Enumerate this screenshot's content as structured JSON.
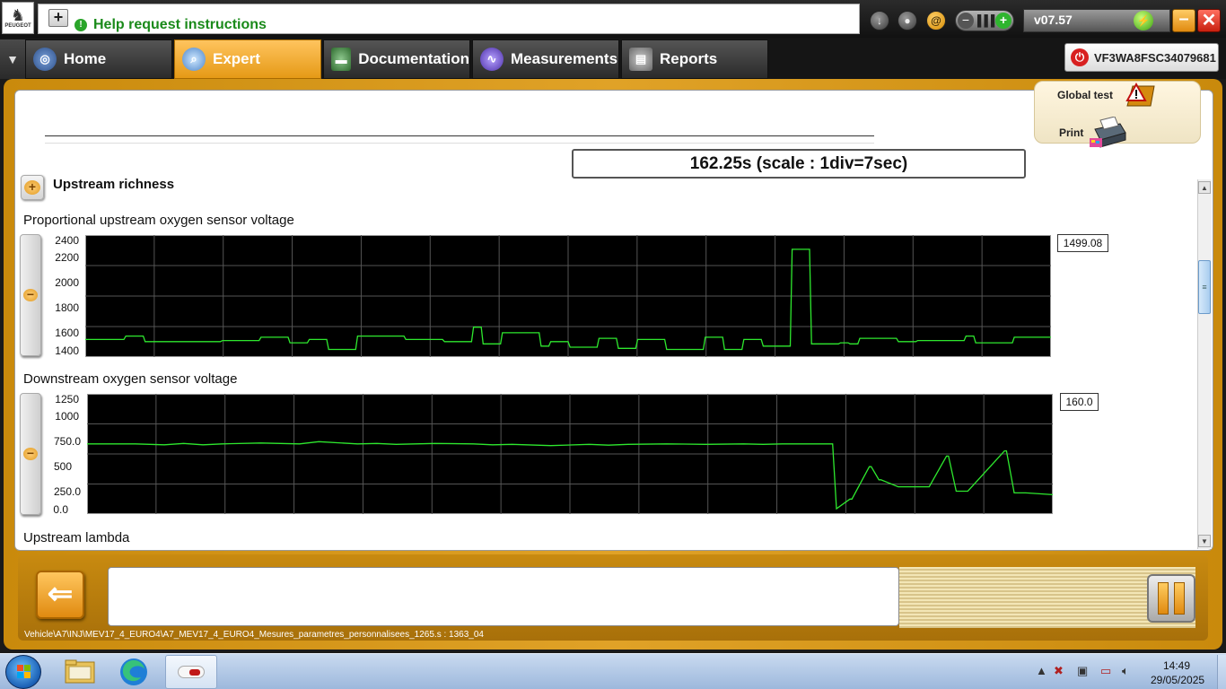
{
  "header": {
    "brand": "PEUGEOT",
    "help_text": "Help request instructions",
    "version": "v07.57"
  },
  "nav": {
    "tabs": [
      {
        "label": "Home",
        "icon": "home-icon"
      },
      {
        "label": "Expert",
        "icon": "magnifier-icon"
      },
      {
        "label": "Documentation",
        "icon": "book-icon"
      },
      {
        "label": "Measurements",
        "icon": "waveform-icon"
      },
      {
        "label": "Reports",
        "icon": "report-icon"
      }
    ],
    "active_tab": "Expert",
    "vin": "VF3WA8FSC34079681"
  },
  "side_panel": {
    "global_test_label": "Global test",
    "print_label": "Print"
  },
  "timebar": "162.25s (scale : 1div=7sec)",
  "group": {
    "title": "Upstream richness"
  },
  "charts_text": {
    "chart1_title": "Proportional upstream oxygen sensor voltage",
    "chart1_value": "1499.08",
    "chart2_title": "Downstream oxygen sensor voltage",
    "chart2_value": "160.0",
    "chart3_title": "Upstream lambda"
  },
  "chart_data": [
    {
      "type": "line",
      "title": "Proportional upstream oxygen sensor voltage",
      "yticks": [
        "2400",
        "2200",
        "2000",
        "1800",
        "1600",
        "1400"
      ],
      "ylim": [
        1400,
        2400
      ],
      "grid": true,
      "color": "#2ee82e",
      "current_value": 1499.08,
      "x": [
        0,
        2,
        4,
        4.2,
        6,
        6.2,
        10,
        10.2,
        14,
        14.2,
        18,
        18.2,
        21,
        21.2,
        23,
        23.2,
        25,
        25.2,
        28,
        28.2,
        33,
        33.2,
        37,
        37.2,
        40,
        40.2,
        41,
        41.2,
        43,
        43.2,
        47,
        47.2,
        48,
        48.2,
        50,
        50.2,
        53,
        53.2,
        55,
        55.2,
        57,
        57.2,
        60,
        60.2,
        64,
        64.2,
        66,
        66.2,
        68,
        68.2,
        70,
        70.2,
        73,
        73.2,
        75,
        75.2,
        78,
        78.2,
        79,
        79.2,
        80,
        80.2,
        84,
        84.2,
        86,
        86.2,
        91,
        91.2,
        92,
        92.2,
        96,
        96.2,
        100
      ],
      "values": [
        1510,
        1510,
        1510,
        1540,
        1540,
        1490,
        1490,
        1490,
        1490,
        1500,
        1500,
        1530,
        1530,
        1480,
        1480,
        1510,
        1510,
        1420,
        1420,
        1540,
        1540,
        1510,
        1510,
        1490,
        1490,
        1620,
        1620,
        1470,
        1470,
        1570,
        1570,
        1450,
        1450,
        1490,
        1490,
        1440,
        1440,
        1520,
        1520,
        1430,
        1430,
        1510,
        1510,
        1420,
        1420,
        1530,
        1530,
        1420,
        1420,
        1510,
        1510,
        1450,
        1450,
        2320,
        2320,
        1470,
        1470,
        1480,
        1480,
        1470,
        1470,
        1520,
        1520,
        1490,
        1490,
        1500,
        1500,
        1540,
        1540,
        1480,
        1480,
        1530,
        1530
      ]
    },
    {
      "type": "line",
      "title": "Downstream oxygen sensor voltage",
      "yticks": [
        "1250",
        "1000",
        "750.0",
        "500",
        "250.0",
        "0.0"
      ],
      "ylim": [
        0,
        1250
      ],
      "grid": true,
      "color": "#2ee82e",
      "current_value": 160.0,
      "x": [
        0,
        5,
        8,
        10,
        12,
        14,
        18,
        22,
        24,
        28,
        30,
        32,
        36,
        40,
        42,
        44,
        48,
        52,
        54,
        56,
        60,
        64,
        68,
        70,
        72,
        76,
        77.2,
        77.6,
        79,
        79.2,
        81,
        81.2,
        82,
        82.2,
        84,
        84.2,
        85,
        85.2,
        87,
        87.2,
        89,
        89.2,
        90,
        90.2,
        91,
        91.2,
        95,
        95.2,
        96,
        96.2,
        97,
        97.2,
        100
      ],
      "values": [
        740,
        740,
        730,
        745,
        730,
        740,
        750,
        740,
        765,
        740,
        745,
        735,
        745,
        740,
        730,
        735,
        720,
        735,
        725,
        735,
        740,
        735,
        740,
        735,
        740,
        740,
        740,
        0,
        110,
        110,
        480,
        480,
        330,
        330,
        250,
        250,
        250,
        250,
        250,
        250,
        600,
        600,
        200,
        200,
        200,
        200,
        660,
        660,
        180,
        180,
        180,
        180,
        160
      ]
    }
  ],
  "footer": {
    "path": "Vehicle\\A7\\INJ\\MEV17_4_EURO4\\A7_MEV17_4_EURO4_Mesures_parametres_personnalisees_1265.s : 1363_04"
  },
  "taskbar": {
    "time": "14:49",
    "date": "29/05/2025"
  }
}
